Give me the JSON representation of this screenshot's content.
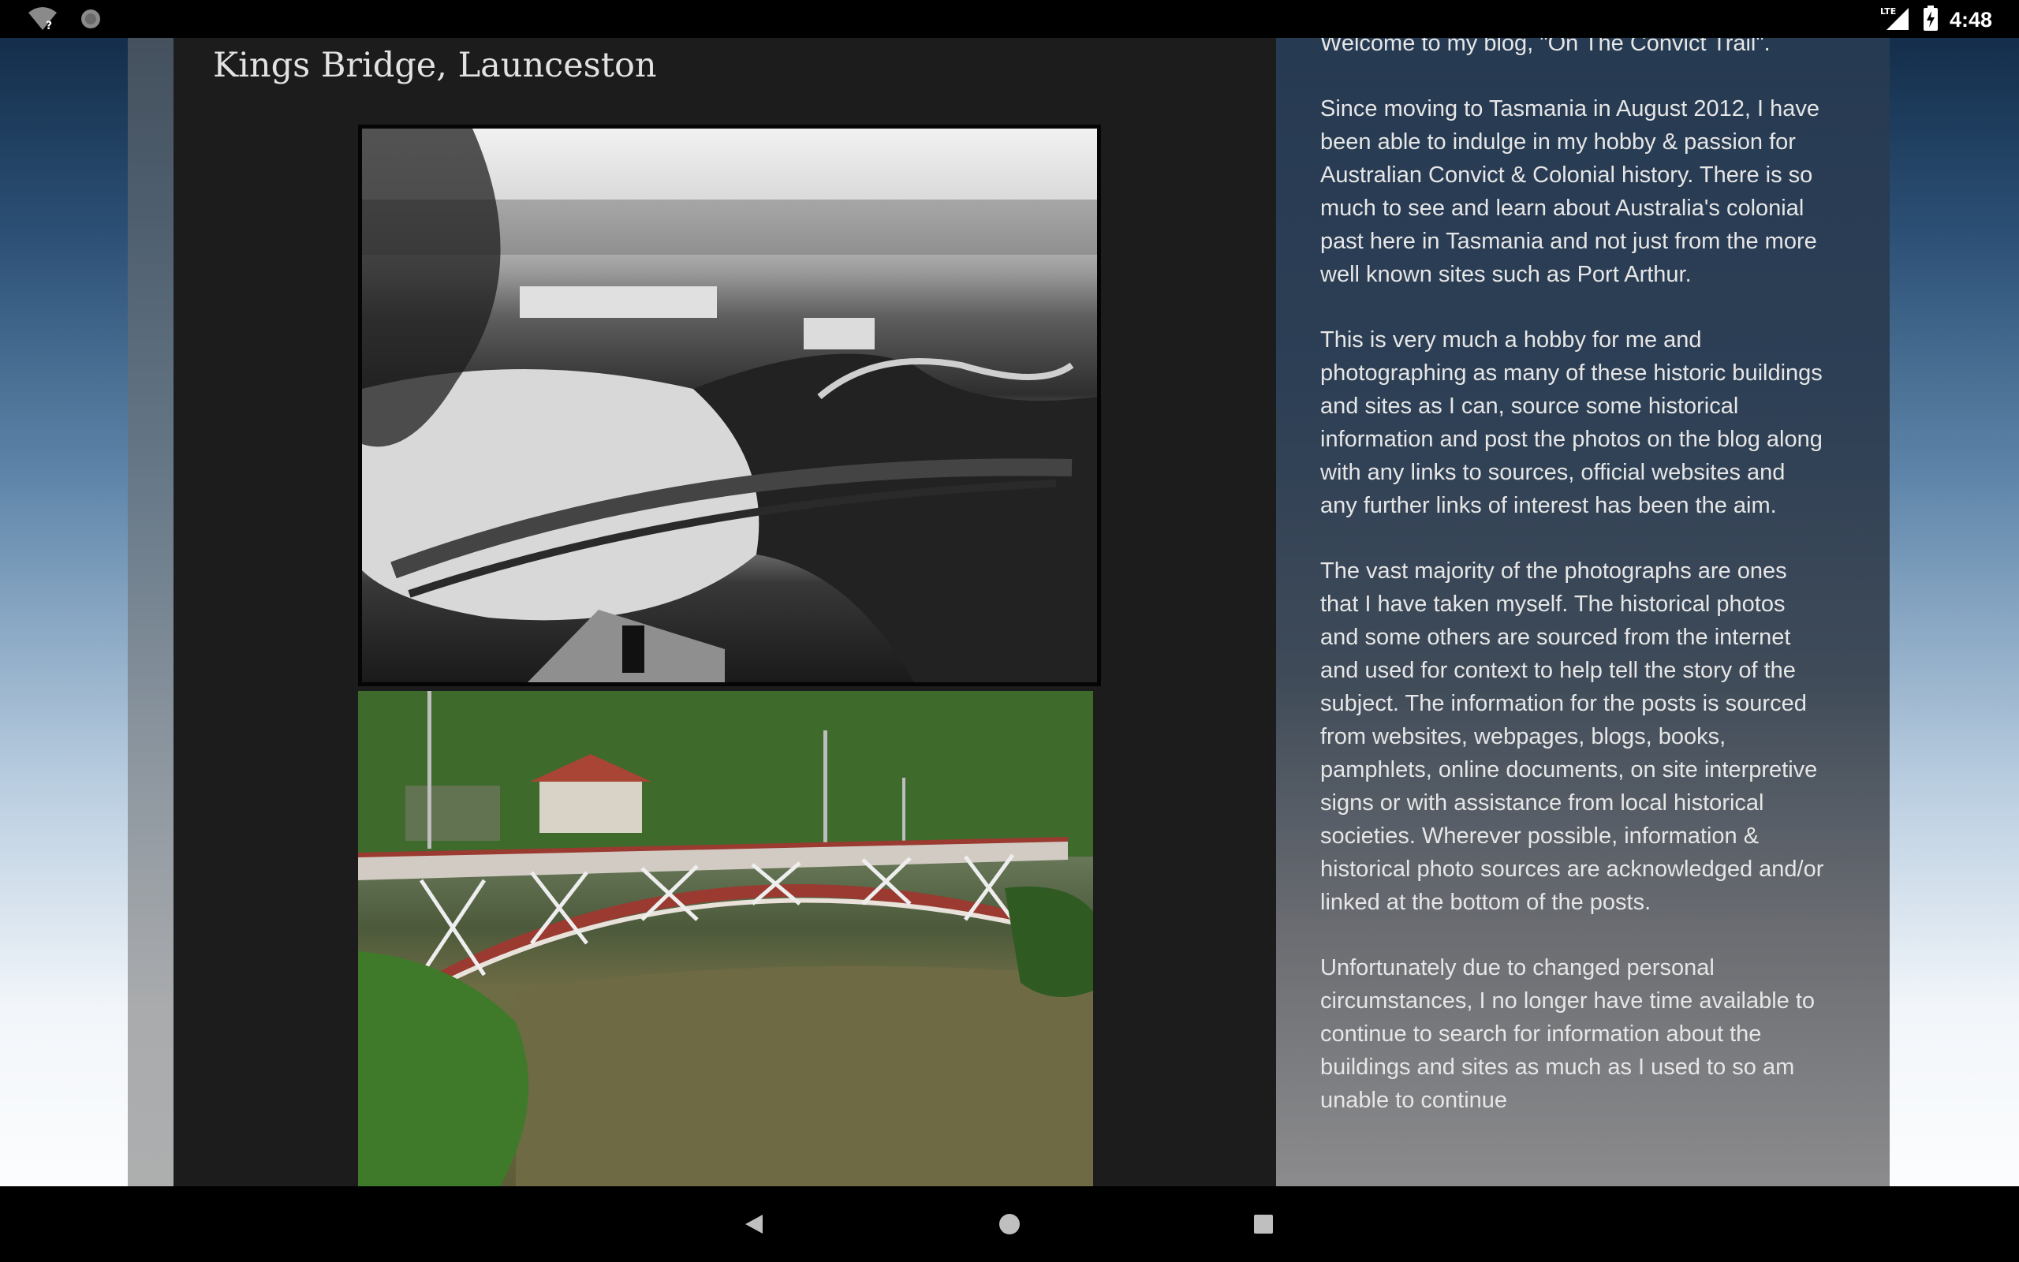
{
  "status_bar": {
    "time": "4:48",
    "network_label": "LTE",
    "icons": [
      "wifi-question-icon",
      "sync-icon",
      "signal-icon",
      "battery-charging-icon"
    ]
  },
  "post": {
    "title": "Kings Bridge, Launceston",
    "images": [
      {
        "name": "historic-photo",
        "description_icon": "photo-black-and-white"
      },
      {
        "name": "modern-photo",
        "description_icon": "photo-color"
      }
    ]
  },
  "sidebar": {
    "paragraphs": [
      "Welcome to my blog, \"On The Convict Trail\".",
      "Since moving to Tasmania in August 2012, I have been able to indulge in my hobby & passion for Australian Convict & Colonial history. There is so much to see and learn about Australia's colonial past here in Tasmania and not just from the more well known sites such as Port Arthur.",
      "This is very much a hobby for me and photographing as many of these historic buildings and sites as I can, source some historical information and post the photos on the blog along with any links to sources, official websites and any further links of interest has been the aim.",
      "The vast majority of the photographs are ones that I have taken myself. The historical photos and some others are sourced from the internet and used for context to help tell the story of the subject. The information for the posts is sourced from websites, webpages, blogs, books, pamphlets, online documents, on site interpretive signs or with assistance from local historical societies. Wherever possible, information & historical photo sources are acknowledged and/or linked at the bottom of the posts.",
      "Unfortunately due to changed personal circumstances, I no longer have time available to continue to search for information about the buildings and sites as much as I used to so am unable to continue"
    ]
  },
  "nav_bar": {
    "buttons": [
      "back-button",
      "home-button",
      "recents-button"
    ]
  },
  "colors": {
    "main_background": "#1c1c1c",
    "sidebar_text": "#e6e6e6",
    "title_text": "#e2e2e2",
    "bridge_red": "#9a3a30"
  }
}
